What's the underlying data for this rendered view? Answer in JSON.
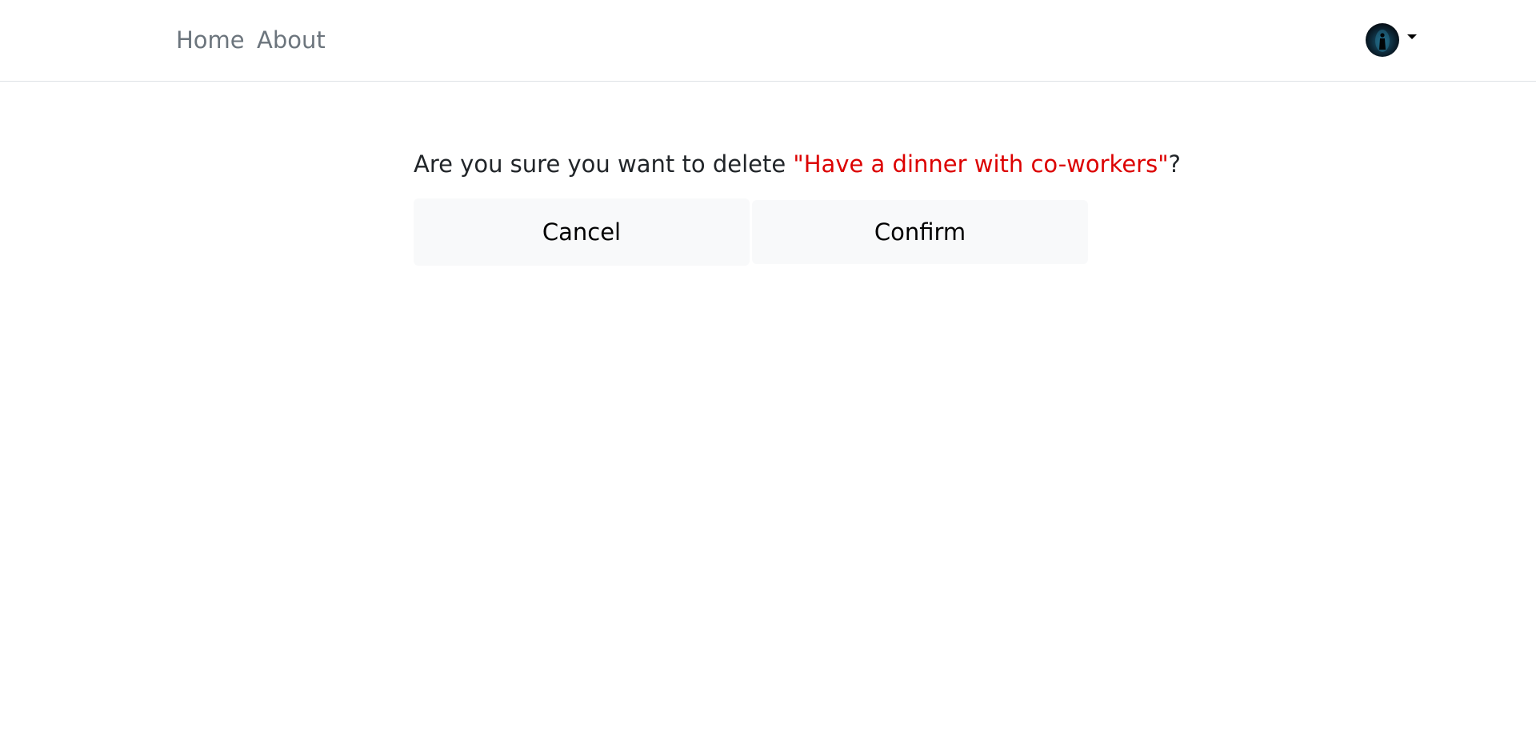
{
  "nav": {
    "home": "Home",
    "about": "About",
    "avatar_icon": "user-avatar",
    "caret_icon": "caret-down-icon"
  },
  "dialog": {
    "question_prefix": "Are you sure you want to delete ",
    "item_name": "\"Have a dinner with co-workers\"",
    "question_suffix": "?",
    "cancel_label": "Cancel",
    "confirm_label": "Confirm"
  },
  "colors": {
    "item_highlight": "#dc0000",
    "nav_link": "#6c757d",
    "button_bg": "#f8f9fa"
  }
}
